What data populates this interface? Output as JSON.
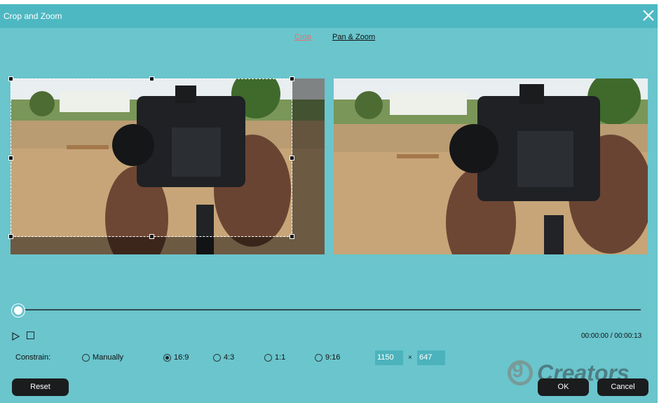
{
  "window": {
    "title": "Crop and Zoom"
  },
  "tabs": [
    {
      "label": "Crop",
      "active": true
    },
    {
      "label": "Pan & Zoom",
      "active": false
    }
  ],
  "playback": {
    "timecode": "00:00:00 / 00:00:13",
    "position": 0
  },
  "constrain": {
    "label": "Constrain:",
    "options": [
      "Manually",
      "16:9",
      "4:3",
      "1:1",
      "9:16"
    ],
    "selected": "16:9",
    "width": "1150",
    "times": "×",
    "height": "647"
  },
  "buttons": {
    "reset": "Reset",
    "ok": "OK",
    "cancel": "Cancel"
  },
  "watermark": {
    "text": "Creators",
    "numeral": "9"
  },
  "colors": {
    "background": "#6ac5cd",
    "titlebar": "#4eb8c2",
    "active_tab": "#e5706a",
    "button": "#1b1c1d"
  }
}
